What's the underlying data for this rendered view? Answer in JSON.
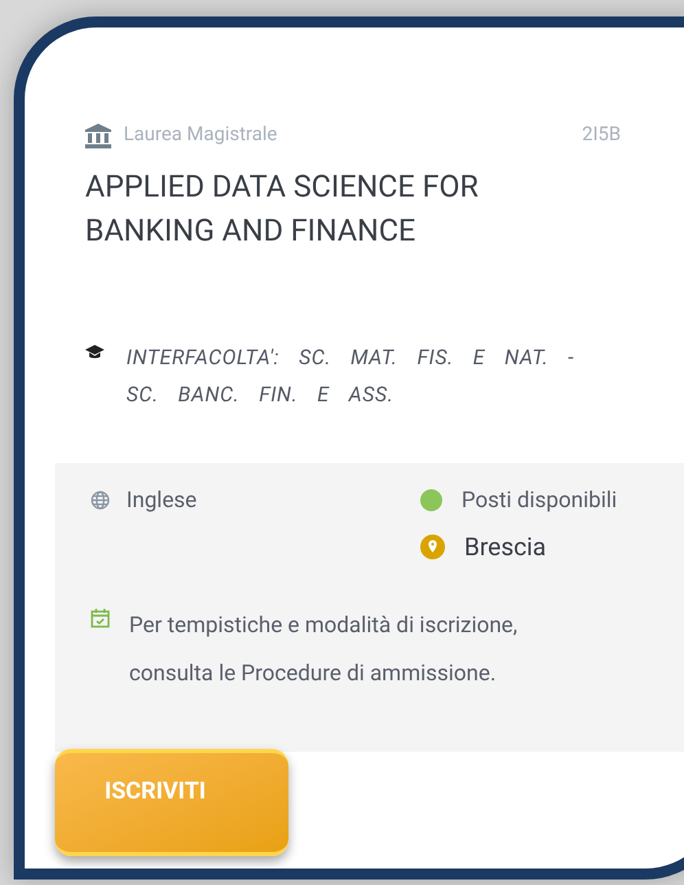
{
  "degree_type": "Laurea Magistrale",
  "code": "2I5B",
  "title": "APPLIED DATA SCIENCE FOR BANKING AND FINANCE",
  "faculty": "INTERFACOLTA': SC. MAT. FIS. E NAT. - SC. BANC. FIN. E ASS.",
  "language": "Inglese",
  "availability": "Posti disponibili",
  "location": "Brescia",
  "note": "Per tempistiche e modalità di iscrizione, consulta le Procedure di ammissione.",
  "button": "ISCRIVITI"
}
